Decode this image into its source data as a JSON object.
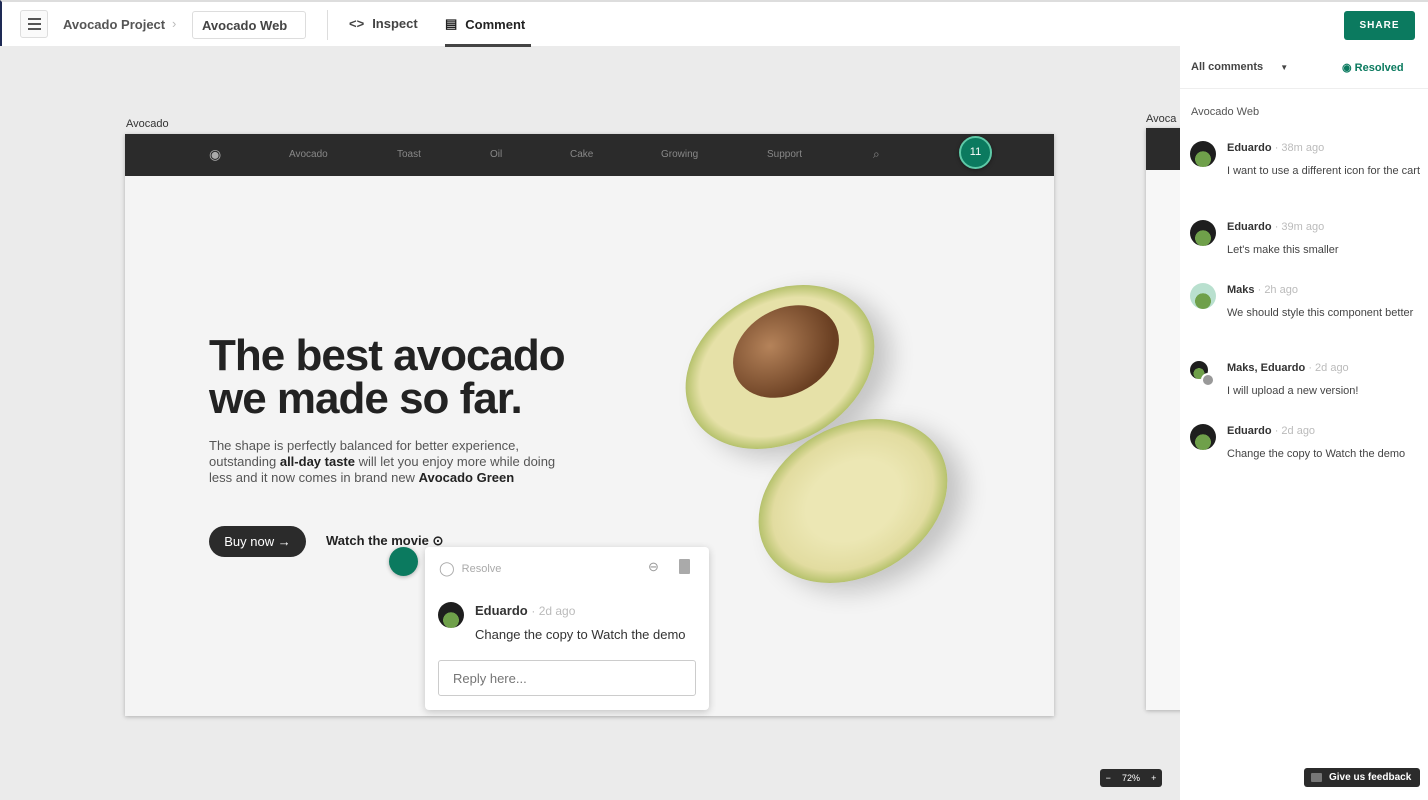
{
  "header": {
    "project": "Avocado Project",
    "file": "Avocado Web",
    "tabs": [
      {
        "label": "Inspect",
        "icon": "code-icon"
      },
      {
        "label": "Comment",
        "icon": "comment-icon",
        "active": true
      }
    ],
    "share": "SHARE"
  },
  "canvas": {
    "artboard_label": "Avocado",
    "artboard2_label": "Avoca",
    "nav": [
      "Avocado",
      "Toast",
      "Oil",
      "Cake",
      "Growing",
      "Support"
    ],
    "comment_count": "11",
    "hero": {
      "title_line1": "The best avocado",
      "title_line2": "we made so far.",
      "body1": "The shape is perfectly balanced for better experience, outstanding ",
      "body_bold1": "all-day taste",
      "body2": " will let you enjoy more while doing less and it now comes in brand new ",
      "body_bold2": "Avocado Green",
      "buy": "Buy now →",
      "watch": "Watch the movie"
    }
  },
  "popup": {
    "resolve": "Resolve",
    "author": "Eduardo",
    "time": "· 2d ago",
    "text": "Change the copy to Watch the demo",
    "reply_placeholder": "Reply here..."
  },
  "panel": {
    "filter": "All comments",
    "resolved": "Resolved",
    "section": "Avocado Web",
    "comments": [
      {
        "author": "Eduardo",
        "time": "· 38m ago",
        "text": "I want to use a different icon for the cart"
      },
      {
        "author": "Eduardo",
        "time": "· 39m ago",
        "text": "Let's make this smaller"
      },
      {
        "author": "Maks",
        "time": "· 2h ago",
        "text": "We should style this component better"
      },
      {
        "author": "Maks, Eduardo",
        "time": "· 2d ago",
        "text": "I will upload a new version!"
      },
      {
        "author": "Eduardo",
        "time": "· 2d ago",
        "text": "Change the copy to Watch the demo"
      }
    ]
  },
  "zoom": {
    "minus": "−",
    "level": "72%",
    "plus": "+"
  },
  "feedback": "Give us feedback",
  "colors": {
    "accent": "#0b7a5f",
    "dark": "#2b2b2b"
  }
}
